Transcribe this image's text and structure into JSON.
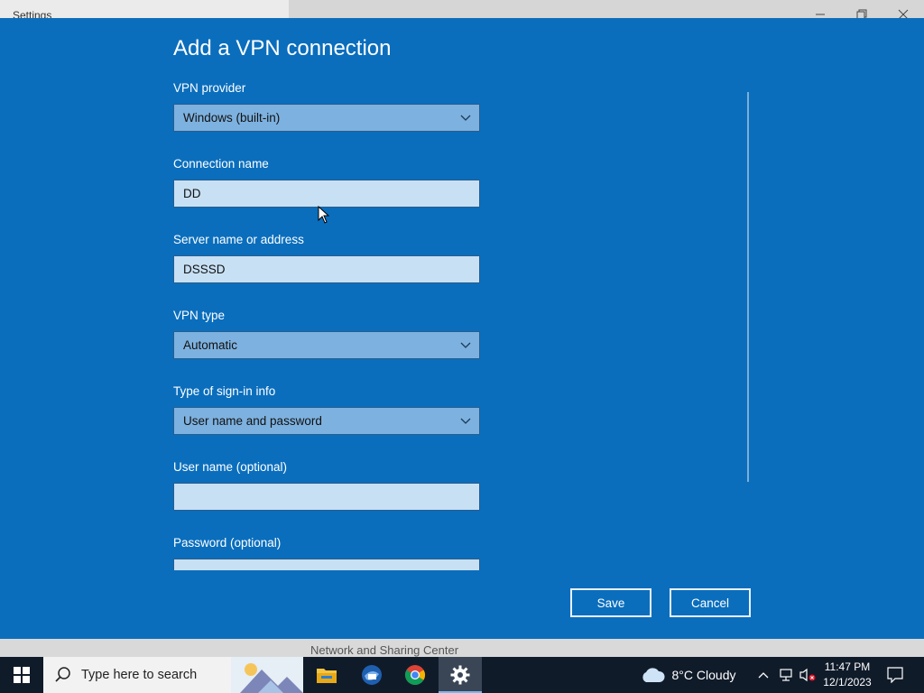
{
  "window": {
    "title": "Settings"
  },
  "background": {
    "link_text": "Network and Sharing Center"
  },
  "dialog": {
    "title": "Add a VPN connection",
    "fields": [
      {
        "label": "VPN provider",
        "value": "Windows (built-in)",
        "kind": "select"
      },
      {
        "label": "Connection name",
        "value": "DD",
        "kind": "input"
      },
      {
        "label": "Server name or address",
        "value": "DSSSD",
        "kind": "input"
      },
      {
        "label": "VPN type",
        "value": "Automatic",
        "kind": "select"
      },
      {
        "label": "Type of sign-in info",
        "value": "User name and password",
        "kind": "select"
      },
      {
        "label": "User name (optional)",
        "value": "",
        "kind": "input"
      },
      {
        "label": "Password (optional)",
        "value": "",
        "kind": "input"
      }
    ],
    "save_label": "Save",
    "cancel_label": "Cancel"
  },
  "taskbar": {
    "search_placeholder": "Type here to search",
    "weather": "8°C  Cloudy",
    "time": "11:47 PM",
    "date": "12/1/2023"
  },
  "colors": {
    "dialog_bg": "#0a6ebd",
    "select_bg": "#7db1df",
    "input_bg": "#c7e0f4",
    "taskbar_bg": "#101b2a"
  }
}
